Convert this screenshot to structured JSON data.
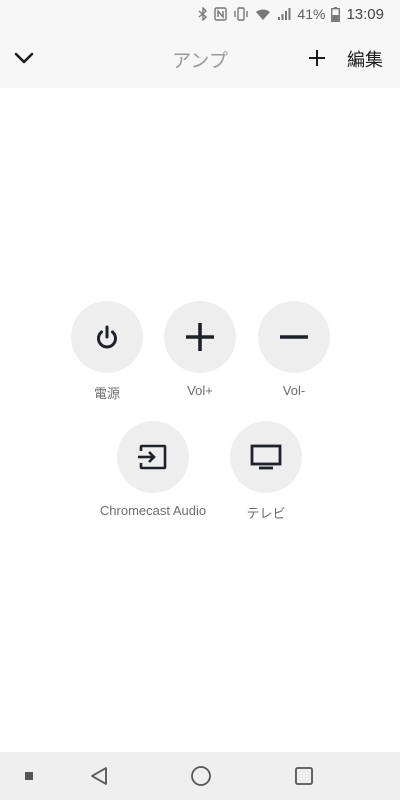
{
  "status_bar": {
    "battery_percent": "41%",
    "time": "13:09",
    "icons": [
      "bluetooth-icon",
      "nfc-icon",
      "vibrate-icon",
      "wifi-icon",
      "signal-icon",
      "battery-icon"
    ]
  },
  "app_bar": {
    "title": "アンプ",
    "edit_label": "編集",
    "icons": [
      "chevron-down-icon",
      "plus-icon"
    ]
  },
  "buttons": [
    {
      "label": "電源",
      "icon": "power-icon"
    },
    {
      "label": "Vol+",
      "icon": "plus-icon"
    },
    {
      "label": "Vol-",
      "icon": "minus-icon"
    },
    {
      "label": "Chromecast Audio",
      "icon": "input-icon"
    },
    {
      "label": "テレビ",
      "icon": "tv-icon"
    }
  ],
  "nav_bar": {
    "icons": [
      "menu-dot-icon",
      "back-icon",
      "home-icon",
      "recents-icon"
    ]
  },
  "colors": {
    "button_bg": "#eeeeee",
    "icon": "#1f2229",
    "label": "#6d6d6d",
    "title": "#9a9a9a"
  }
}
